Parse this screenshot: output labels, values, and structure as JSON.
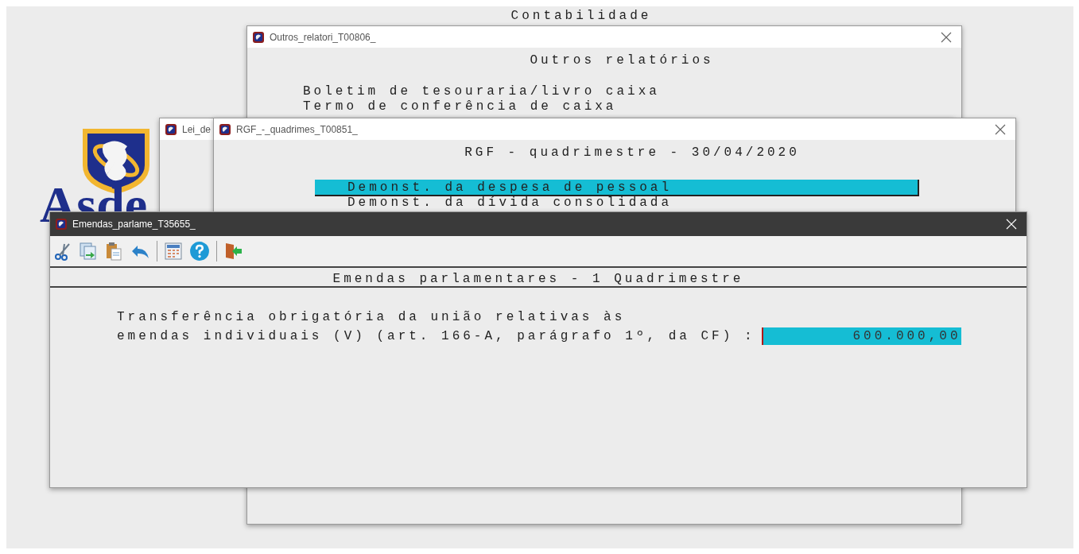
{
  "app": {
    "title": "Contabilidade",
    "logo_text": "Asde"
  },
  "windows": [
    {
      "kind": "menu",
      "title": "Outros_relatori_T00806_",
      "active": false,
      "heading": "Outros relatórios",
      "items": [
        {
          "label": "Boletim de tesouraria/livro caixa",
          "selected": false
        },
        {
          "label": "Termo de conferência de caixa",
          "selected": false
        }
      ]
    },
    {
      "kind": "stub",
      "title": "Lei_de",
      "active": false
    },
    {
      "kind": "menu",
      "title": "RGF_-_quadrimes_T00851_",
      "active": false,
      "heading": "RGF - quadrimestre - 30/04/2020",
      "items": [
        {
          "label": "Demonst. da despesa de pessoal",
          "selected": true
        },
        {
          "label": "Demonst. da dívida consolidada",
          "selected": false
        }
      ]
    },
    {
      "kind": "form",
      "title": "Emendas_parlame_T35655_",
      "active": true,
      "heading": "Emendas parlamentares - 1 Quadrimestre",
      "fields": [
        {
          "label_lines": [
            "Transferência obrigatória da união relativas às",
            "emendas individuais (V) (art. 166-A, parágrafo 1º, da CF) :"
          ],
          "value": "600.000,00"
        }
      ]
    }
  ]
}
